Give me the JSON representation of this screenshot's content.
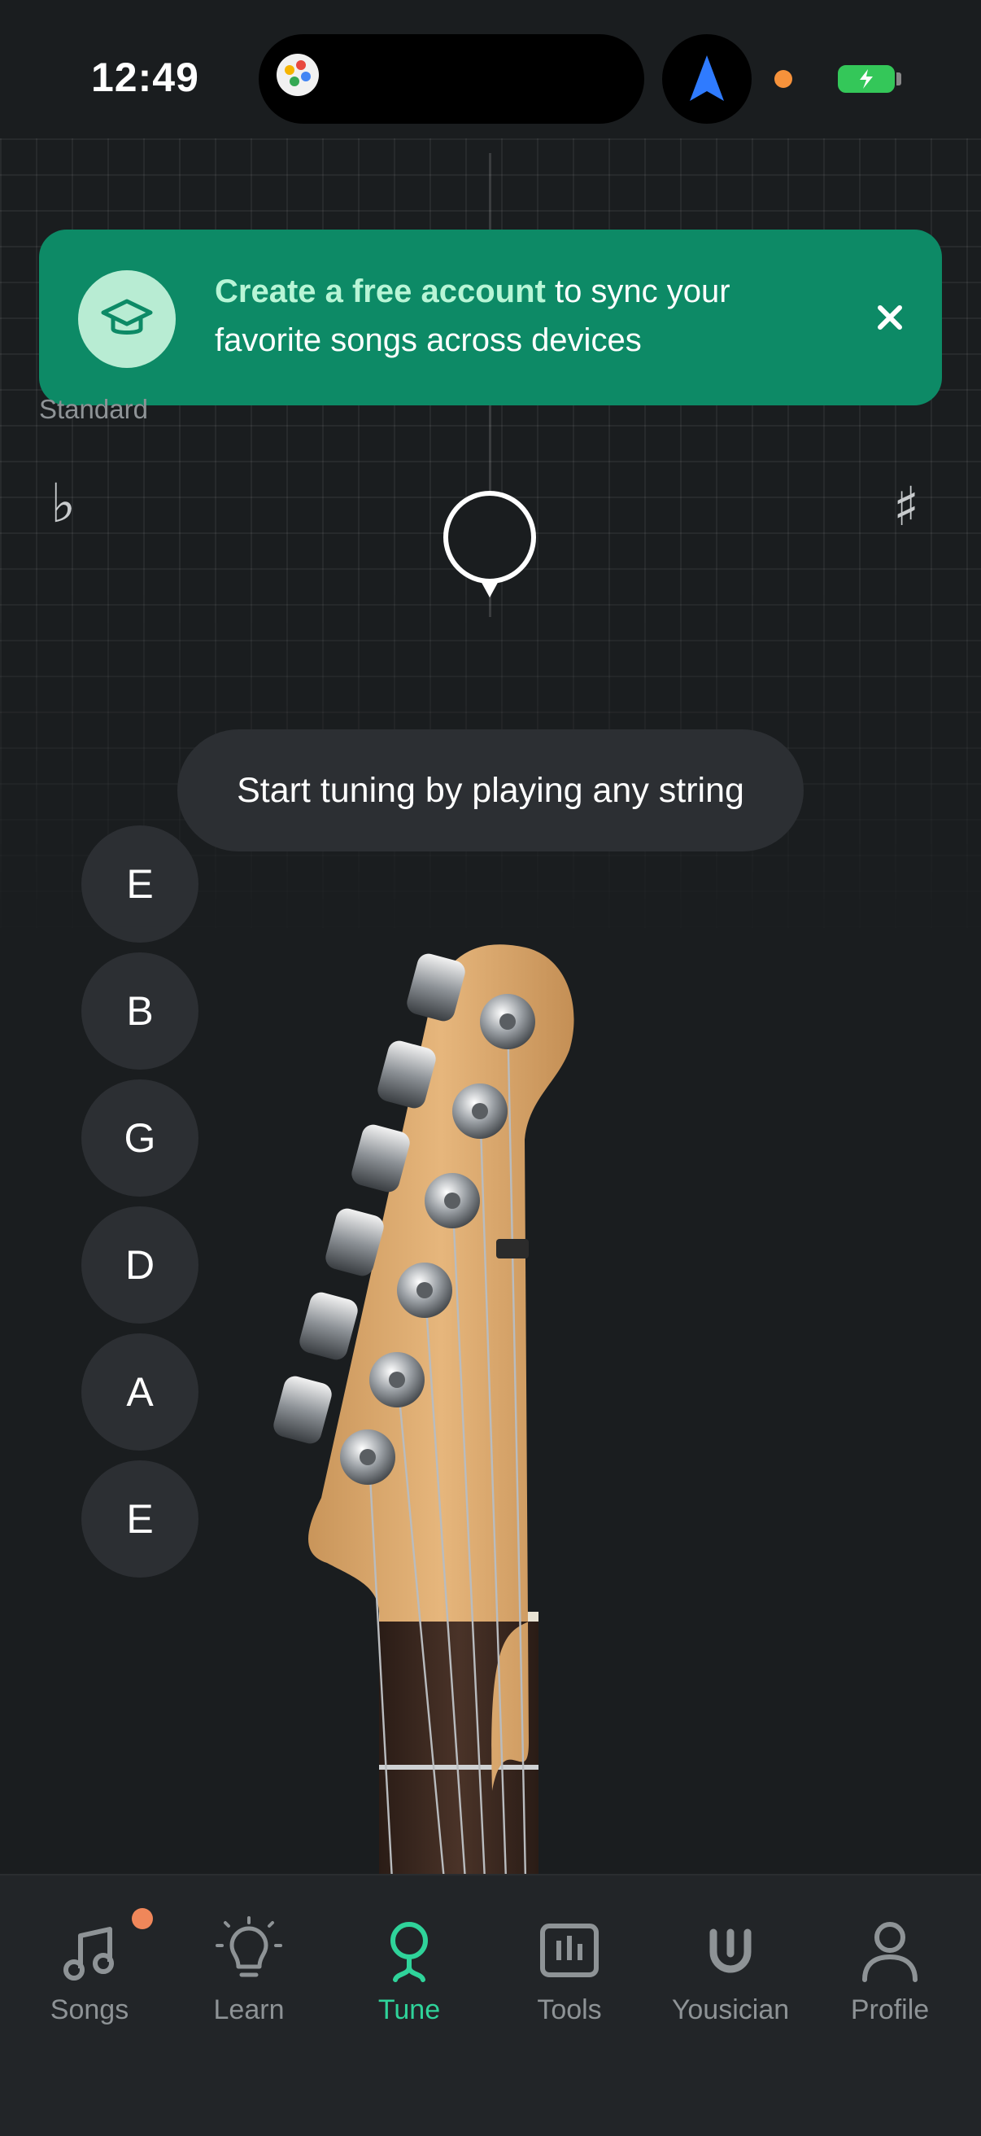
{
  "status_bar": {
    "time": "12:49"
  },
  "banner": {
    "highlight": "Create a free account",
    "rest": " to sync your favorite songs across devices"
  },
  "tuner": {
    "tuning_name": "Standard",
    "flat_symbol": "♭",
    "sharp_symbol": "♯",
    "prompt": "Start tuning by playing any string",
    "strings": [
      "E",
      "B",
      "G",
      "D",
      "A",
      "E"
    ]
  },
  "tabs": [
    {
      "label": "Songs",
      "icon": "music-note-icon",
      "active": false,
      "badge": true
    },
    {
      "label": "Learn",
      "icon": "lightbulb-icon",
      "active": false
    },
    {
      "label": "Tune",
      "icon": "tuner-icon",
      "active": true
    },
    {
      "label": "Tools",
      "icon": "metronome-icon",
      "active": false
    },
    {
      "label": "Yousician",
      "icon": "yousician-logo-icon",
      "active": false
    },
    {
      "label": "Profile",
      "icon": "person-icon",
      "active": false
    }
  ],
  "colors": {
    "background": "#1a1d1f",
    "banner": "#0d8a66",
    "accent": "#2fd39a",
    "badge": "#f0875a"
  }
}
